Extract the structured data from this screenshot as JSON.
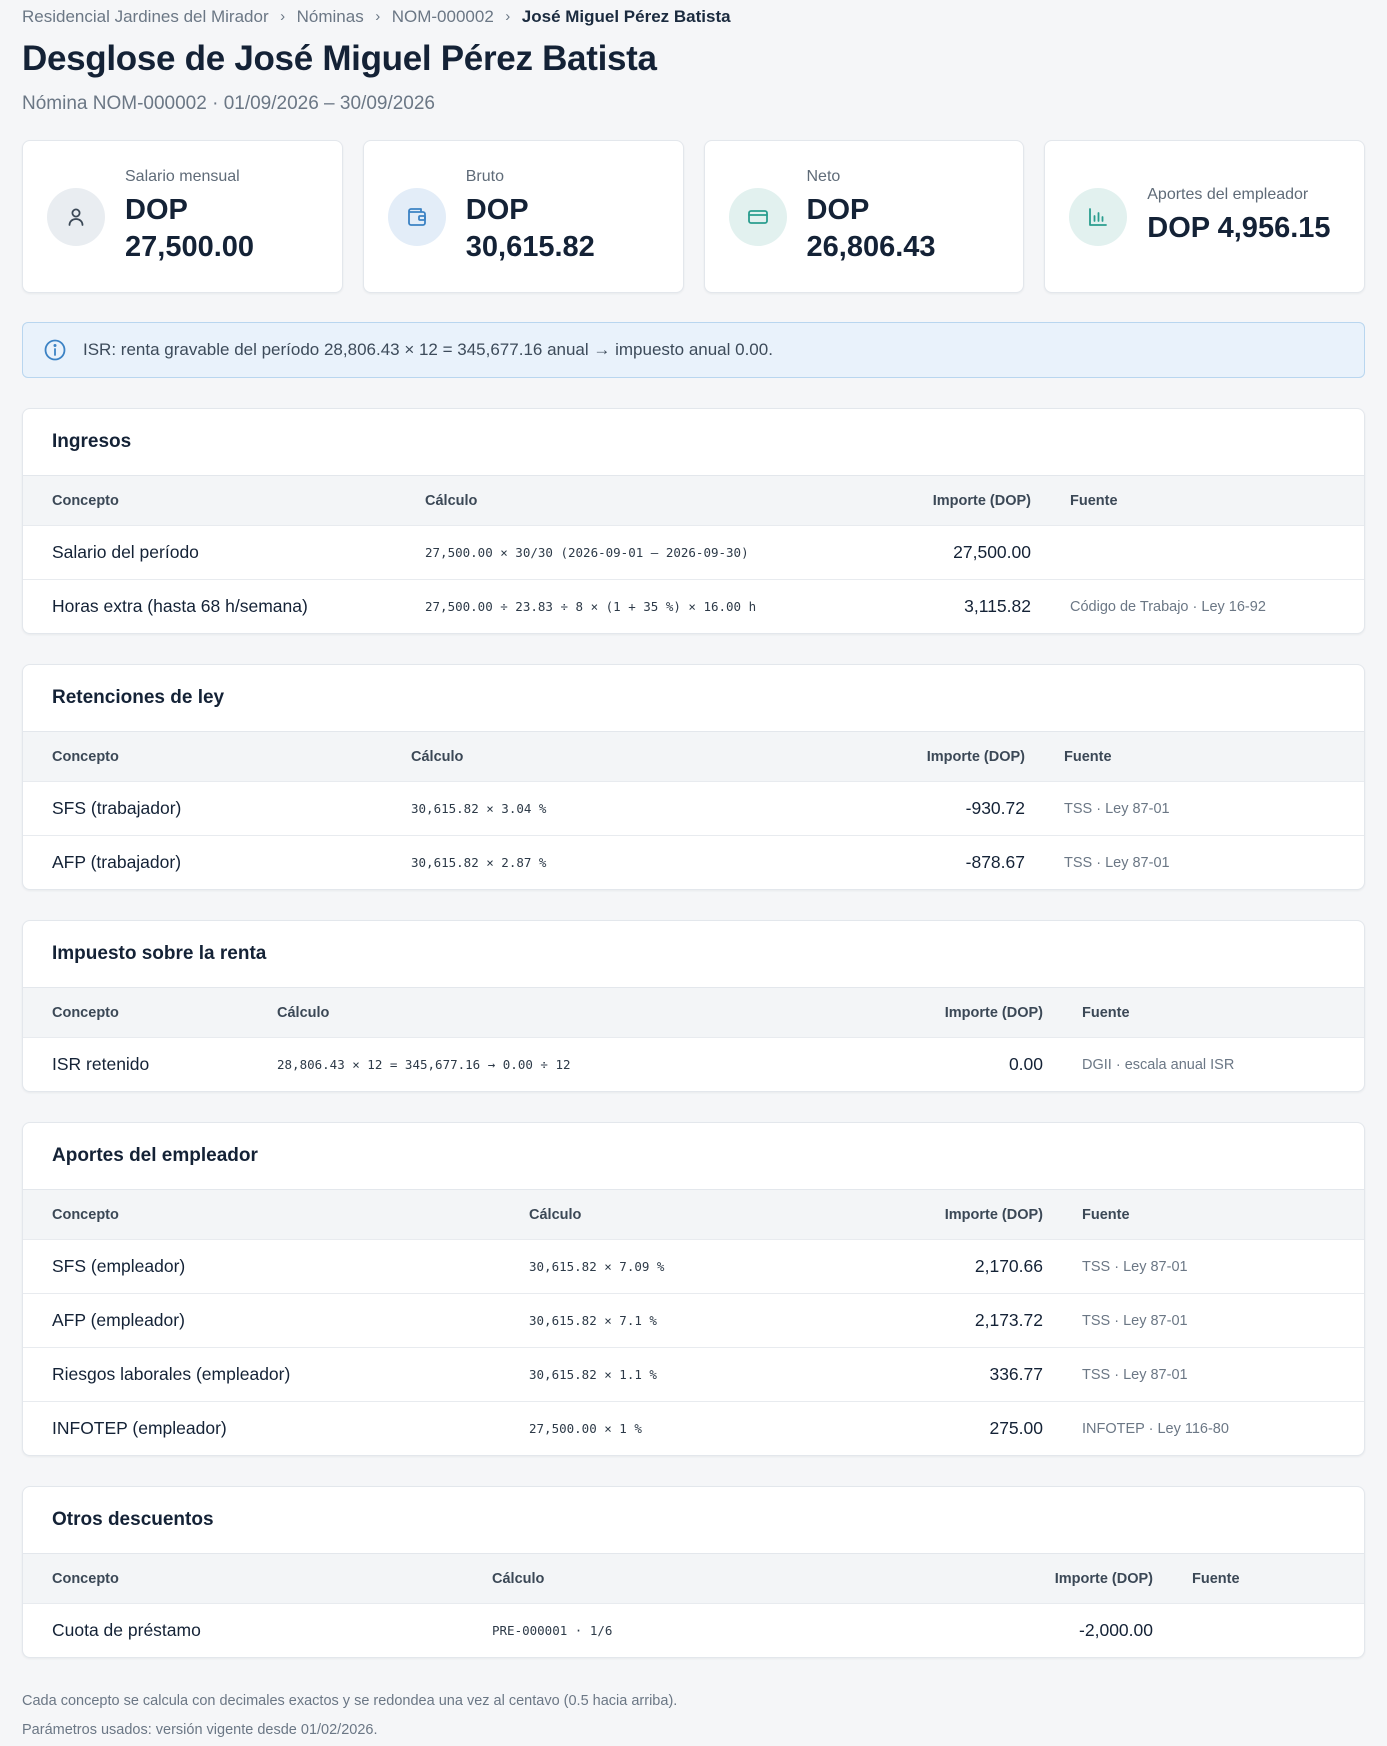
{
  "breadcrumb": [
    "Residencial Jardines del Mirador",
    "Nóminas",
    "NOM-000002",
    "José Miguel Pérez Batista"
  ],
  "title": "Desglose de José Miguel Pérez Batista",
  "subtitle": "Nómina NOM-000002 · 01/09/2026 – 30/09/2026",
  "stats": [
    {
      "label": "Salario mensual",
      "value_line1": "DOP",
      "value_line2": "27,500.00",
      "icon": "user-icon",
      "color": "#e9edf1"
    },
    {
      "label": "Bruto",
      "value_line1": "DOP",
      "value_line2": "30,615.82",
      "icon": "wallet-icon",
      "color": "#e3edf8"
    },
    {
      "label": "Neto",
      "value_line1": "DOP",
      "value_line2": "26,806.43",
      "icon": "credit-card-icon",
      "color": "#e2f1ef"
    },
    {
      "label": "Aportes del empleador",
      "value_line1": "DOP 4,956.15",
      "value_line2": "",
      "icon": "bar-chart-icon",
      "color": "#e2f1ef"
    }
  ],
  "info": "ISR: renta gravable del período 28,806.43 × 12 = 345,677.16 anual → impuesto anual 0.00.",
  "headers": {
    "concept": "Concepto",
    "calc": "Cálculo",
    "amount": "Importe (DOP)",
    "source": "Fuente"
  },
  "sections": {
    "ingresos": {
      "title": "Ingresos",
      "rows": [
        {
          "concept": "Salario del período",
          "calc": "27,500.00 × 30/30 (2026-09-01 – 2026-09-30)",
          "amount": "27,500.00",
          "source": ""
        },
        {
          "concept": "Horas extra (hasta 68 h/semana)",
          "calc": "27,500.00 ÷ 23.83 ÷ 8 × (1 + 35 %) × 16.00 h",
          "amount": "3,115.82",
          "source": "Código de Trabajo · Ley 16-92"
        }
      ]
    },
    "retenciones": {
      "title": "Retenciones de ley",
      "rows": [
        {
          "concept": "SFS (trabajador)",
          "calc": "30,615.82 × 3.04 %",
          "amount": "-930.72",
          "source": "TSS · Ley 87-01"
        },
        {
          "concept": "AFP (trabajador)",
          "calc": "30,615.82 × 2.87 %",
          "amount": "-878.67",
          "source": "TSS · Ley 87-01"
        }
      ]
    },
    "isr": {
      "title": "Impuesto sobre la renta",
      "rows": [
        {
          "concept": "ISR retenido",
          "calc": "28,806.43 × 12 = 345,677.16 → 0.00 ÷ 12",
          "amount": "0.00",
          "source": "DGII · escala anual ISR"
        }
      ]
    },
    "aportes": {
      "title": "Aportes del empleador",
      "rows": [
        {
          "concept": "SFS (empleador)",
          "calc": "30,615.82 × 7.09 %",
          "amount": "2,170.66",
          "source": "TSS · Ley 87-01"
        },
        {
          "concept": "AFP (empleador)",
          "calc": "30,615.82 × 7.1 %",
          "amount": "2,173.72",
          "source": "TSS · Ley 87-01"
        },
        {
          "concept": "Riesgos laborales (empleador)",
          "calc": "30,615.82 × 1.1 %",
          "amount": "336.77",
          "source": "TSS · Ley 87-01"
        },
        {
          "concept": "INFOTEP (empleador)",
          "calc": "27,500.00 × 1 %",
          "amount": "275.00",
          "source": "INFOTEP · Ley 116-80"
        }
      ]
    },
    "otros": {
      "title": "Otros descuentos",
      "rows": [
        {
          "concept": "Cuota de préstamo",
          "calc": "PRE-000001 · 1/6",
          "amount": "-2,000.00",
          "source": ""
        }
      ]
    }
  },
  "footer": [
    "Cada concepto se calcula con decimales exactos y se redondea una vez al centavo (0.5 hacia arriba).",
    "Parámetros usados: versión vigente desde 01/02/2026."
  ],
  "colors": {
    "icon_gray": "#3b4856",
    "icon_blue": "#3b82c4",
    "icon_teal": "#2a9d8f",
    "info_blue": "#3b82c4"
  }
}
